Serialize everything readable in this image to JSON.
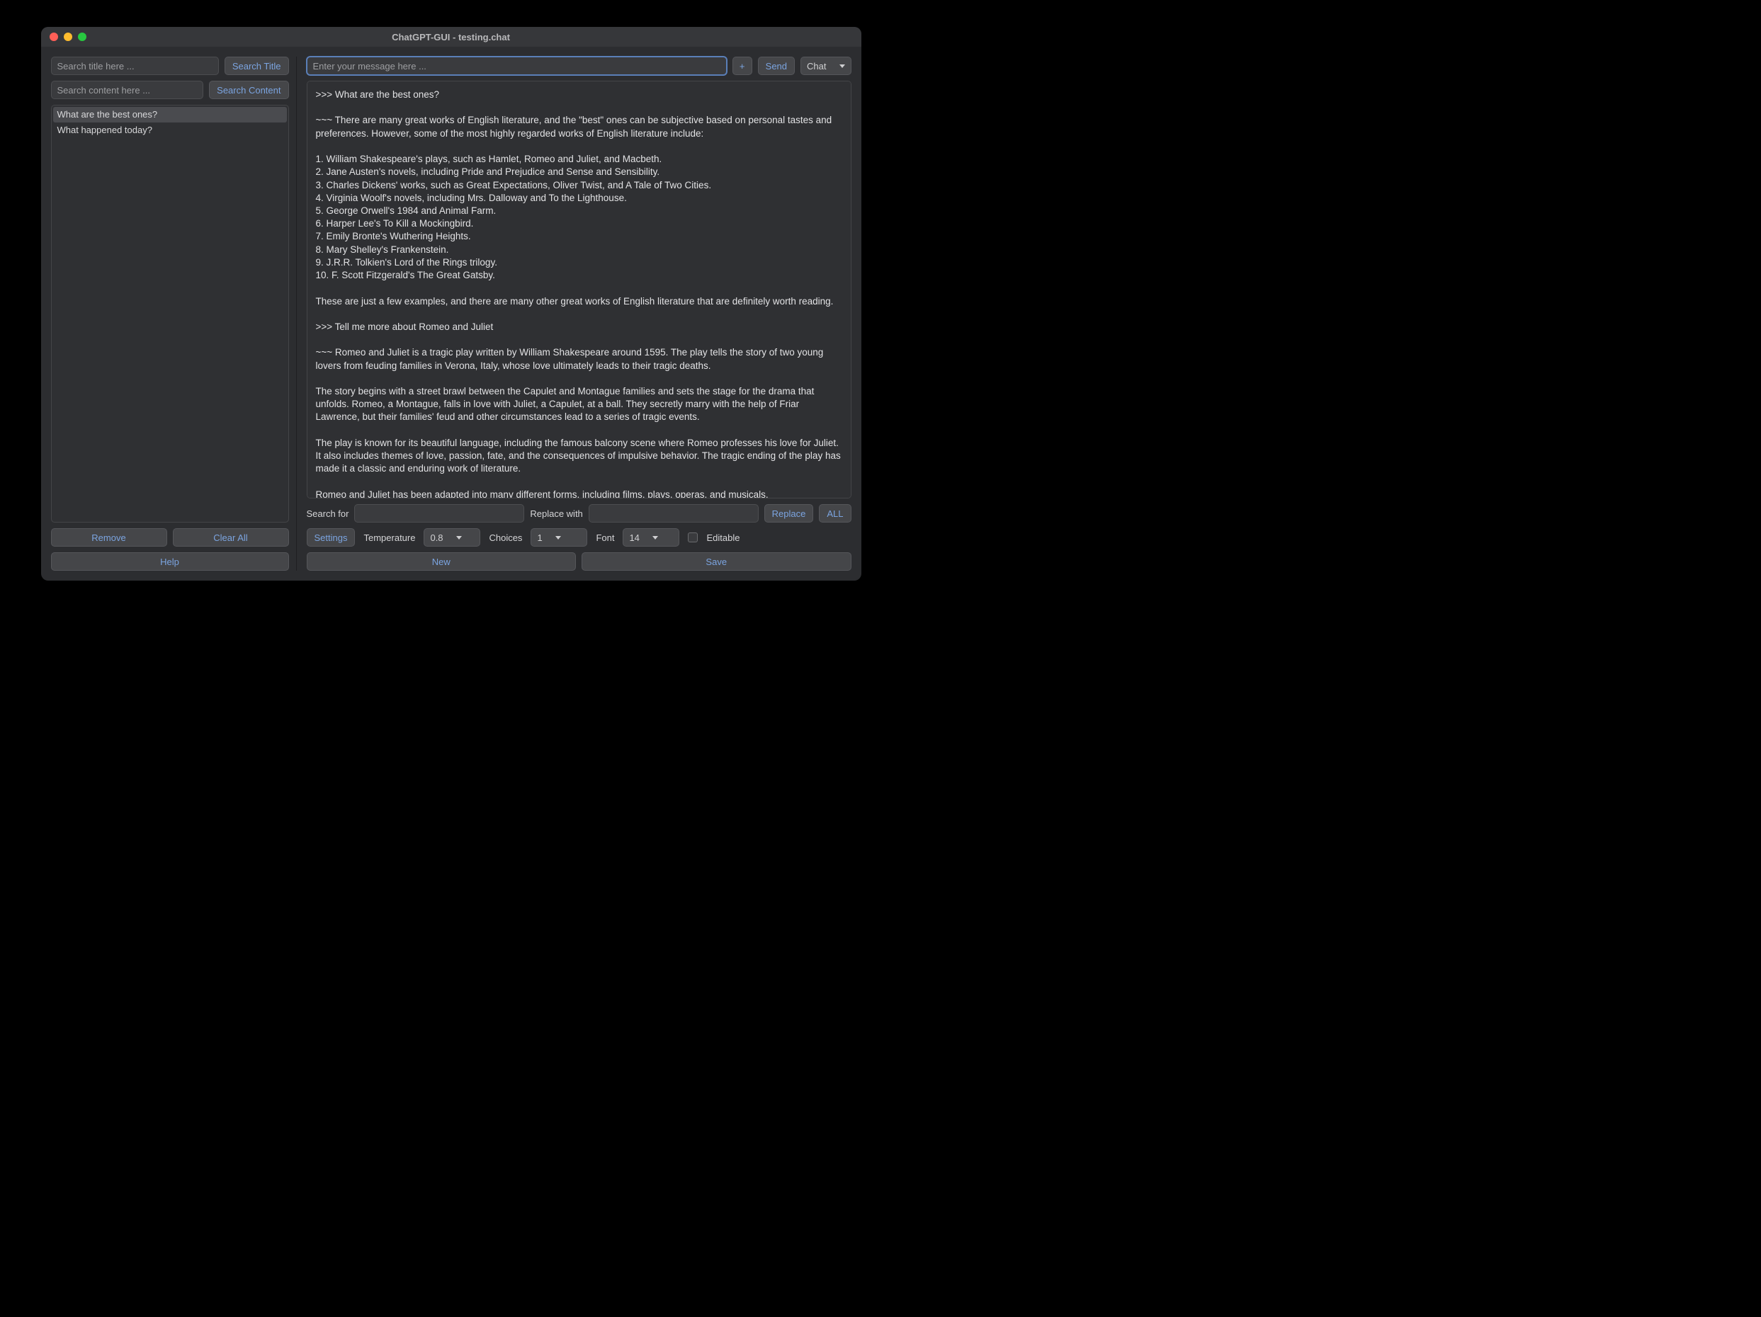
{
  "window": {
    "title": "ChatGPT-GUI - testing.chat"
  },
  "left": {
    "search_title_placeholder": "Search title here ...",
    "search_title_button": "Search Title",
    "search_content_placeholder": "Search content here ...",
    "search_content_button": "Search Content",
    "list": [
      {
        "label": "What are the best ones?",
        "selected": true
      },
      {
        "label": "What happened today?",
        "selected": false
      }
    ],
    "remove_button": "Remove",
    "clear_all_button": "Clear All",
    "help_button": "Help"
  },
  "right": {
    "message_placeholder": "Enter your message here ...",
    "plus_button": "+",
    "send_button": "Send",
    "mode_select": "Chat",
    "chat_text": ">>> What are the best ones?\n\n~~~ There are many great works of English literature, and the \"best\" ones can be subjective based on personal tastes and preferences. However, some of the most highly regarded works of English literature include:\n\n1. William Shakespeare's plays, such as Hamlet, Romeo and Juliet, and Macbeth.\n2. Jane Austen's novels, including Pride and Prejudice and Sense and Sensibility.\n3. Charles Dickens' works, such as Great Expectations, Oliver Twist, and A Tale of Two Cities.\n4. Virginia Woolf's novels, including Mrs. Dalloway and To the Lighthouse.\n5. George Orwell's 1984 and Animal Farm.\n6. Harper Lee's To Kill a Mockingbird.\n7. Emily Bronte's Wuthering Heights.\n8. Mary Shelley's Frankenstein.\n9. J.R.R. Tolkien's Lord of the Rings trilogy.\n10. F. Scott Fitzgerald's The Great Gatsby.\n\nThese are just a few examples, and there are many other great works of English literature that are definitely worth reading.\n\n>>> Tell me more about Romeo and Juliet\n\n~~~ Romeo and Juliet is a tragic play written by William Shakespeare around 1595. The play tells the story of two young lovers from feuding families in Verona, Italy, whose love ultimately leads to their tragic deaths.\n\nThe story begins with a street brawl between the Capulet and Montague families and sets the stage for the drama that unfolds. Romeo, a Montague, falls in love with Juliet, a Capulet, at a ball. They secretly marry with the help of Friar Lawrence, but their families' feud and other circumstances lead to a series of tragic events.\n\nThe play is known for its beautiful language, including the famous balcony scene where Romeo professes his love for Juliet. It also includes themes of love, passion, fate, and the consequences of impulsive behavior. The tragic ending of the play has made it a classic and enduring work of literature.\n\nRomeo and Juliet has been adapted into many different forms, including films, plays, operas, and musicals.",
    "search_for_label": "Search for",
    "replace_with_label": "Replace with",
    "replace_button": "Replace",
    "all_button": "ALL",
    "settings_button": "Settings",
    "temperature_label": "Temperature",
    "temperature_value": "0.8",
    "choices_label": "Choices",
    "choices_value": "1",
    "font_label": "Font",
    "font_value": "14",
    "editable_label": "Editable",
    "new_button": "New",
    "save_button": "Save"
  }
}
